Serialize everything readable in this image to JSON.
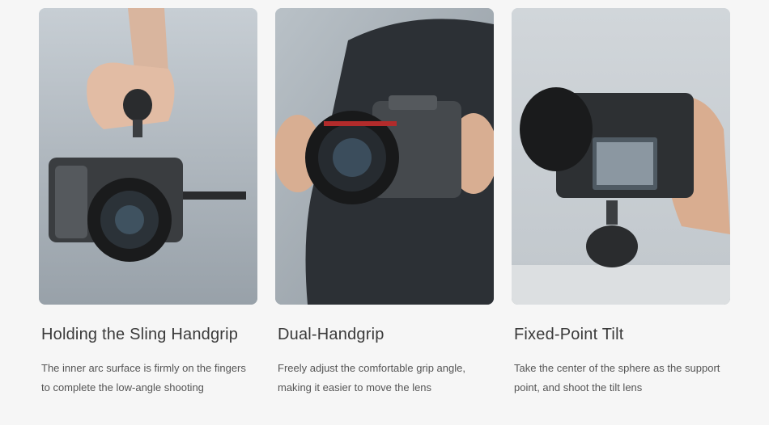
{
  "features": [
    {
      "title": "Holding the Sling Handgrip",
      "desc": [
        "The inner arc surface is firmly on the fingers",
        "to complete the low-angle shooting"
      ],
      "photo": "camera-cage-sling-handgrip-photo"
    },
    {
      "title": "Dual-Handgrip",
      "desc": [
        "Freely adjust the comfortable grip angle,",
        "making it easier to move the lens"
      ],
      "photo": "camera-cage-dual-handgrip-photo"
    },
    {
      "title": "Fixed-Point Tilt",
      "desc": [
        "Take the center of the sphere as the support",
        "point, and shoot the tilt lens"
      ],
      "photo": "camera-cage-tilt-photo"
    }
  ],
  "colors": {
    "background": "#f6f6f6",
    "title": "#3a3a3a",
    "text": "#555555"
  }
}
